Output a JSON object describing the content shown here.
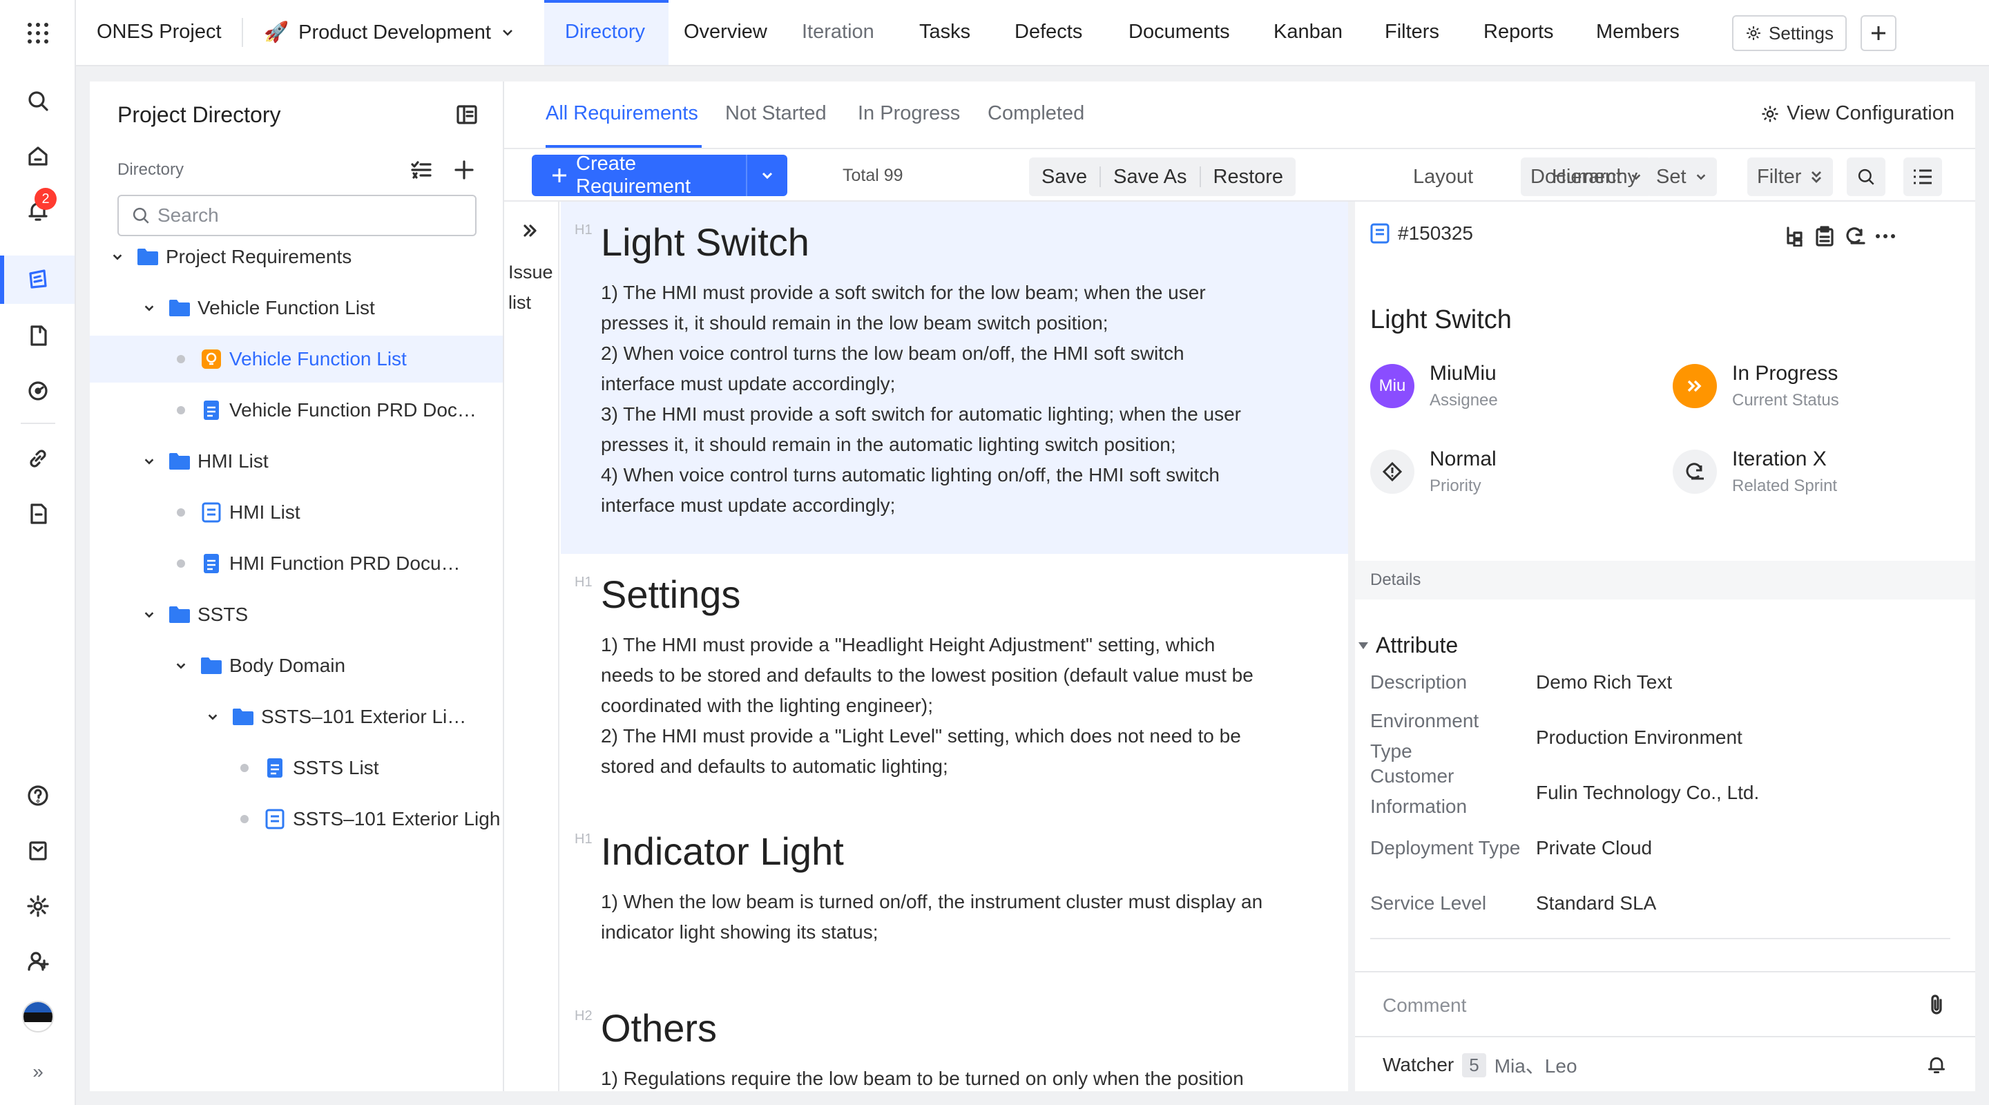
{
  "app": {
    "project_label": "ONES Project",
    "project_emoji": "🚀",
    "project_name": "Product Development"
  },
  "nav": {
    "tabs": [
      "Directory",
      "Overview",
      "Iteration",
      "Tasks",
      "Defects",
      "Documents",
      "Kanban",
      "Filters",
      "Reports",
      "Members"
    ],
    "active": "Directory",
    "settings_label": "Settings"
  },
  "rail": {
    "notification_count": "2",
    "collapse_glyph": "»"
  },
  "directory": {
    "title": "Project Directory",
    "subtitle": "Directory",
    "search_placeholder": "Search",
    "tree": [
      {
        "label": "Project Requirements",
        "kind": "folder"
      },
      {
        "label": "Vehicle Function List",
        "kind": "folder"
      },
      {
        "label": "Vehicle Function List",
        "kind": "bulb",
        "selected": true
      },
      {
        "label": "Vehicle Function PRD Doc…",
        "kind": "doc"
      },
      {
        "label": "HMI List",
        "kind": "folder"
      },
      {
        "label": "HMI List",
        "kind": "list"
      },
      {
        "label": "HMI Function PRD Docu…",
        "kind": "doc"
      },
      {
        "label": "SSTS",
        "kind": "folder"
      },
      {
        "label": "Body Domain",
        "kind": "folder"
      },
      {
        "label": "SSTS–101 Exterior Li…",
        "kind": "folder"
      },
      {
        "label": "SSTS List",
        "kind": "doc"
      },
      {
        "label": "SSTS–101 Exterior Ligh",
        "kind": "list"
      }
    ]
  },
  "main": {
    "subtabs": [
      "All Requirements",
      "Not Started",
      "In Progress",
      "Completed"
    ],
    "active_subtab": "All Requirements",
    "view_config": "View Configuration",
    "create_label": "Create Requirement",
    "total": "Total 99",
    "save": "Save",
    "save_as": "Save As",
    "restore": "Restore",
    "layout_label": "Layout",
    "layout_value": "Document",
    "hierarchy_label": "Hierarchy",
    "hierarchy_value": "Set",
    "filter_label": "Filter",
    "issue_list_line1": "Issue",
    "issue_list_line2": "list"
  },
  "document": {
    "sections": [
      {
        "tag": "H1",
        "title": "Light Switch",
        "lines": [
          "1) The HMI must provide a soft switch for the low beam; when the user",
          "presses it, it should remain in the low beam switch position;",
          "2) When voice control turns the low beam on/off, the HMI soft switch",
          "interface must update accordingly;",
          "3) The HMI must provide a soft switch for automatic lighting; when the user",
          "presses it, it should remain in the automatic lighting switch position;",
          "4) When voice control turns automatic lighting on/off, the HMI soft switch",
          "interface must update accordingly;"
        ]
      },
      {
        "tag": "H1",
        "title": "Settings",
        "lines": [
          "1) The HMI must provide a \"Headlight Height Adjustment\" setting, which",
          "needs to be stored and defaults to the lowest position (default value must be",
          "coordinated with the lighting engineer);",
          "2) The HMI must provide a \"Light Level\" setting, which does not need to be",
          "stored and defaults to automatic lighting;"
        ]
      },
      {
        "tag": "H1",
        "title": "Indicator Light",
        "lines": [
          "1) When the low beam is turned on/off, the instrument cluster must display an",
          "indicator light showing its status;"
        ]
      },
      {
        "tag": "H2",
        "title": "Others",
        "lines": [
          "1) Regulations require the low beam to be turned on only when the position"
        ]
      }
    ]
  },
  "detail": {
    "id": "#150325",
    "title": "Light Switch",
    "assignee": {
      "avatar_text": "Miu",
      "value": "MiuMiu",
      "label": "Assignee"
    },
    "status": {
      "value": "In Progress",
      "label": "Current Status"
    },
    "priority": {
      "value": "Normal",
      "label": "Priority"
    },
    "sprint": {
      "value": "Iteration X",
      "label": "Related Sprint"
    },
    "details_label": "Details",
    "attribute_title": "Attribute",
    "attributes": [
      {
        "label": "Description",
        "value": "Demo Rich Text"
      },
      {
        "label": "Environment Type",
        "label_line1": "Environment",
        "label_line2": "Type",
        "value": "Production Environment"
      },
      {
        "label": "Customer Information",
        "label_line1": "Customer",
        "label_line2": "Information",
        "value": "Fulin Technology Co., Ltd."
      },
      {
        "label": "Deployment Type",
        "value": "Private Cloud"
      },
      {
        "label": "Service Level",
        "value": "Standard SLA"
      }
    ],
    "comment_placeholder": "Comment",
    "watcher_label": "Watcher",
    "watcher_count": "5",
    "watcher_names": "Mia、Leo"
  },
  "colors": {
    "accent": "#2f6bff",
    "folder": "#2f7bf5",
    "status_orange": "#ff9500",
    "avatar_purple": "#8a4dff",
    "badge_red": "#ff3b30"
  }
}
